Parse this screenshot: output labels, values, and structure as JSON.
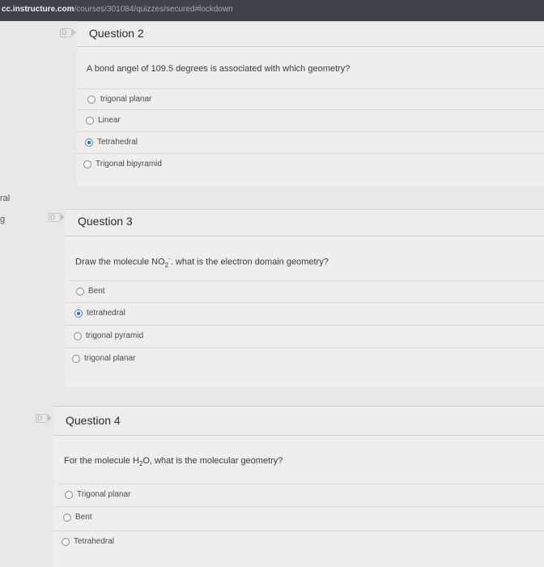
{
  "browser": {
    "url_host": "cc.instructure.com",
    "url_path": "/courses/301084/quizzes/secured#lockdown"
  },
  "sidebar": {
    "item_1": "ral",
    "item_2": "g"
  },
  "questions": [
    {
      "title": "Question 2",
      "prompt": "A bond angel of 109.5 degrees is associated with which geometry?",
      "answers": [
        {
          "label": "trigonal planar",
          "selected": false
        },
        {
          "label": "Linear",
          "selected": false
        },
        {
          "label": "Tetrahedral",
          "selected": true
        },
        {
          "label": "Trigonal bipyramid",
          "selected": false
        }
      ]
    },
    {
      "title": "Question 3",
      "prompt_before": "Draw the molecule NO",
      "prompt_sub": "2",
      "prompt_sup": "-",
      "prompt_after": ". what is the electron domain geometry?",
      "answers": [
        {
          "label": "Bent",
          "selected": false
        },
        {
          "label": "tetrahedral",
          "selected": true
        },
        {
          "label": "trigonal pyramid",
          "selected": false
        },
        {
          "label": "trigonal planar",
          "selected": false
        }
      ]
    },
    {
      "title": "Question 4",
      "prompt_before": "For the molecule H",
      "prompt_sub": "2",
      "prompt_after": "O, what is the molecular geometry?",
      "answers": [
        {
          "label": "Trigonal planar",
          "selected": false
        },
        {
          "label": "Bent",
          "selected": false
        },
        {
          "label": "Tetrahedral",
          "selected": false
        }
      ]
    }
  ],
  "colors": {
    "selected_radio": "#2b66c4",
    "page_bg": "#e9e8e6"
  }
}
